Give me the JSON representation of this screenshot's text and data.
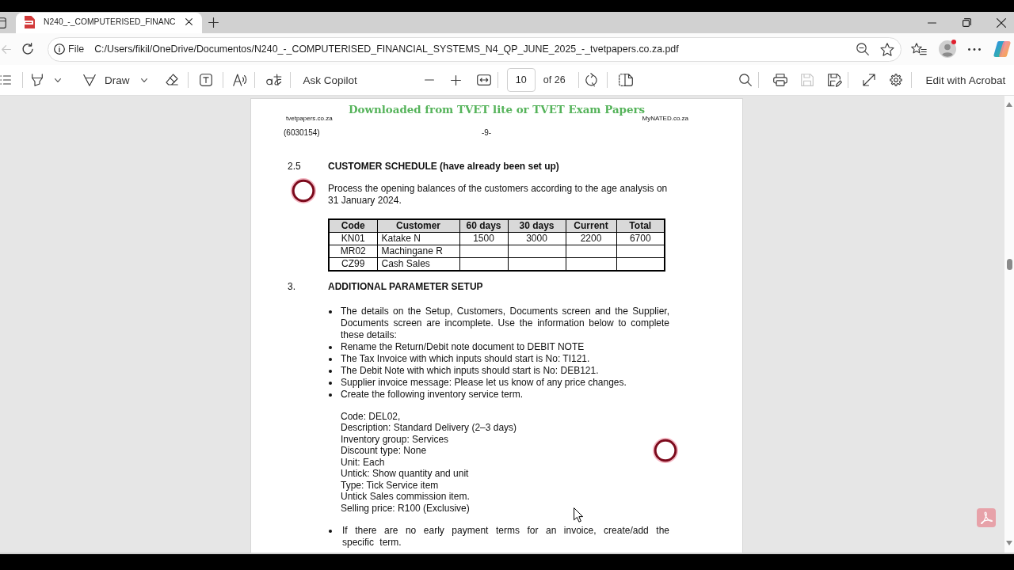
{
  "tabs": [
    {
      "title": "N240_-_COMPUTERISED_FINANC",
      "selected": true
    }
  ],
  "navigation": {
    "back": {
      "disabled": true
    }
  },
  "address_bar": {
    "scheme": "File",
    "url": "C:/Users/fikil/OneDrive/Documentos/N240_-_COMPUTERISED_FINANCIAL_SYSTEMS_N4_QP_JUNE_2025_-_tvetpapers.co.za.pdf"
  },
  "pdf_toolbar": {
    "draw": "Draw",
    "ask_copilot": "Ask Copilot",
    "page_number": "10",
    "page_count": "of 26",
    "save": {
      "disabled": true
    },
    "edit": "Edit with Acrobat"
  },
  "document": {
    "banner": "Downloaded from TVET lite or TVET Exam Papers",
    "header_left": "tvetpapers.co.za",
    "header_right": "MyNATED.co.za",
    "paper_code": "(6030154)",
    "page_label": "-9-",
    "sections": [
      {
        "number": "2.5",
        "heading": "CUSTOMER SCHEDULE (have already been set up)",
        "blocks": [
          {
            "kind": "paragraph",
            "text": "Process the opening balances of the customers according to the age analysis on 31 January 2024."
          },
          {
            "kind": "table",
            "columns": [
              "Code",
              "Customer",
              "60 days",
              "30 days",
              "Current",
              "Total"
            ],
            "rows": [
              [
                "KN01",
                "Katake N",
                "1500",
                "3000",
                "2200",
                "6700"
              ],
              [
                "MR02",
                "Machingane R",
                null,
                null,
                null,
                null
              ],
              [
                "CZ99",
                "Cash Sales",
                null,
                null,
                null,
                null
              ]
            ]
          }
        ]
      },
      {
        "number": "3.",
        "heading": "ADDITIONAL PARAMETER SETUP",
        "blocks": [
          {
            "kind": "bullets",
            "items": [
              "The details on the Setup, Customers, Documents screen and the Supplier, Documents screen are incomplete. Use the information below to complete these details:",
              "Rename the Return/Debit note document to DEBIT NOTE",
              "The Tax Invoice with which inputs should start is No: TI121.",
              "The Debit Note with which inputs should start is No: DEB121.",
              "Supplier invoice message: Please let us know of any price changes.",
              "Create the following inventory service term."
            ]
          },
          {
            "kind": "lines",
            "lines": [
              "Code: DEL02,",
              "Description: Standard Delivery (2–3 days)",
              "Inventory group: Services",
              "Discount type: None",
              "Unit: Each",
              "Untick: Show quantity and unit",
              "Type: Tick Service item",
              "Untick Sales commission item.",
              "Selling price: R100 (Exclusive)"
            ]
          },
          {
            "kind": "bullets",
            "items": [
              "If there are no early payment terms for an invoice, create/add the specific term."
            ]
          }
        ]
      }
    ]
  }
}
